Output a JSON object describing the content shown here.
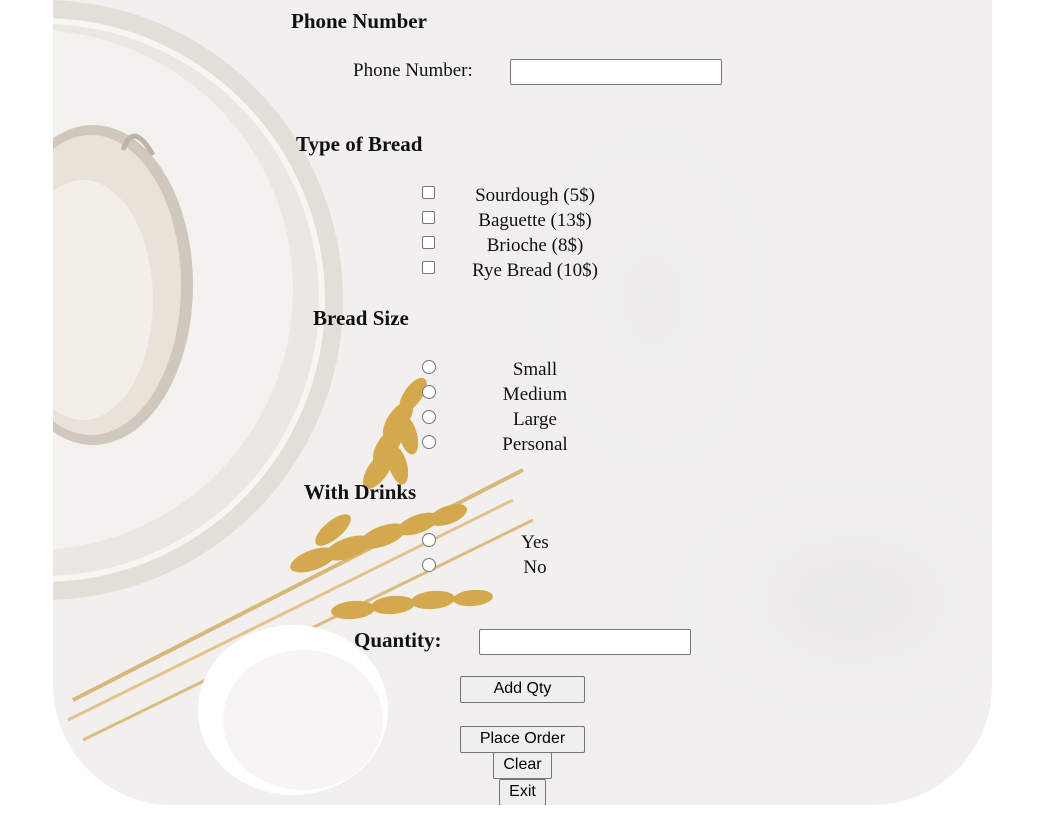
{
  "phone": {
    "heading": "Phone Number",
    "label": "Phone Number:",
    "value": ""
  },
  "bread_type": {
    "heading": "Type of Bread",
    "options": [
      {
        "label": "Sourdough (5$)",
        "checked": false
      },
      {
        "label": "Baguette (13$)",
        "checked": false
      },
      {
        "label": "Brioche (8$)",
        "checked": false
      },
      {
        "label": "Rye Bread (10$)",
        "checked": false
      }
    ]
  },
  "bread_size": {
    "heading": "Bread Size",
    "options": [
      {
        "label": "Small",
        "selected": false
      },
      {
        "label": "Medium",
        "selected": false
      },
      {
        "label": "Large",
        "selected": false
      },
      {
        "label": "Personal",
        "selected": false
      }
    ]
  },
  "drinks": {
    "heading": "With Drinks",
    "options": [
      {
        "label": "Yes",
        "selected": false
      },
      {
        "label": "No",
        "selected": false
      }
    ]
  },
  "quantity": {
    "label": "Quantity:",
    "value": ""
  },
  "buttons": {
    "add_qty": "Add Qty",
    "place_order": "Place Order",
    "clear": "Clear",
    "exit": "Exit"
  },
  "colors": {
    "background": "#f1f0ee",
    "wheat": "#d4a84c",
    "bowl": "#e6e2dc"
  }
}
